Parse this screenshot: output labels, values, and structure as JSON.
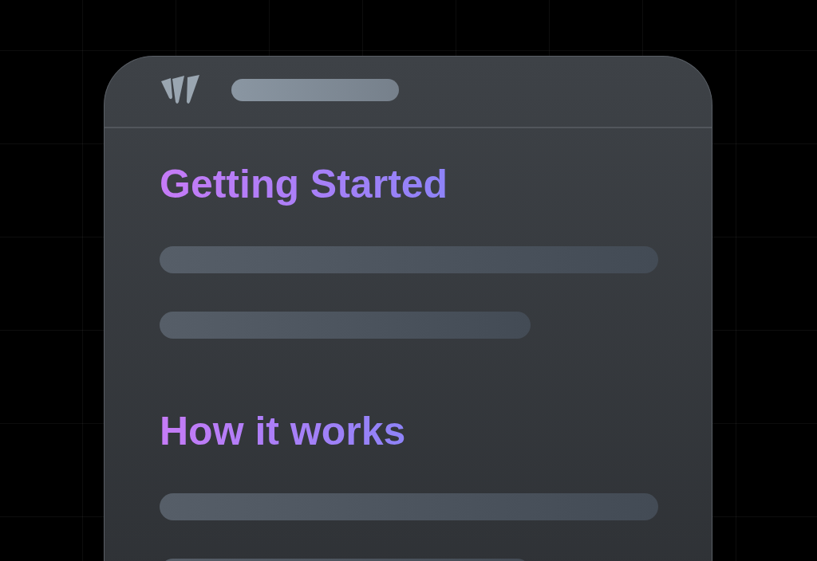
{
  "sections": [
    {
      "heading": "Getting Started"
    },
    {
      "heading": "How it works"
    }
  ]
}
